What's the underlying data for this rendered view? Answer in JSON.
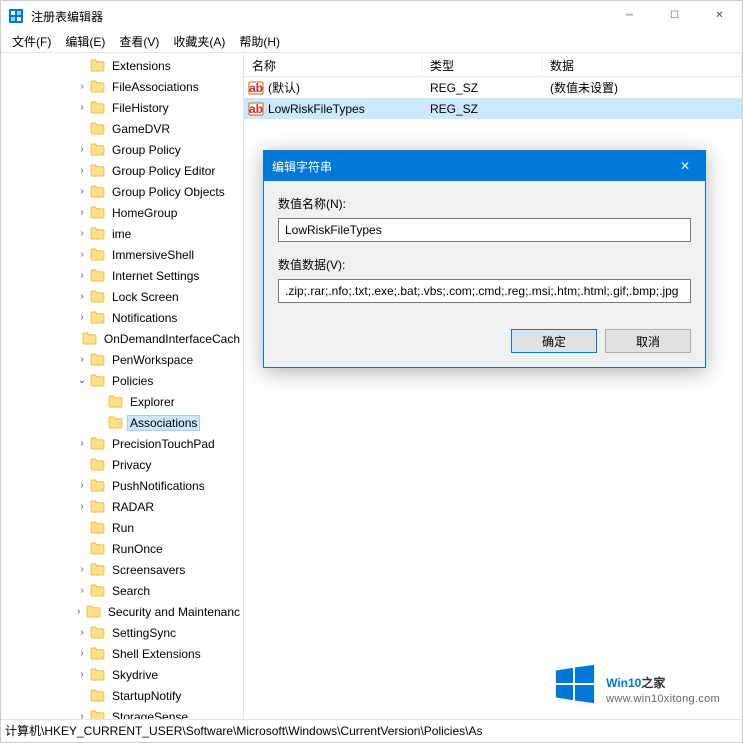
{
  "window": {
    "title": "注册表编辑器"
  },
  "menu": {
    "file": "文件(F)",
    "edit": "编辑(E)",
    "view": "查看(V)",
    "favorites": "收藏夹(A)",
    "help": "帮助(H)"
  },
  "tree_items": [
    {
      "label": "Extensions",
      "depth": 3,
      "expandable": false,
      "expanded": false
    },
    {
      "label": "FileAssociations",
      "depth": 3,
      "expandable": true,
      "expanded": false
    },
    {
      "label": "FileHistory",
      "depth": 3,
      "expandable": true,
      "expanded": false
    },
    {
      "label": "GameDVR",
      "depth": 3,
      "expandable": false,
      "expanded": false
    },
    {
      "label": "Group Policy",
      "depth": 3,
      "expandable": true,
      "expanded": false
    },
    {
      "label": "Group Policy Editor",
      "depth": 3,
      "expandable": true,
      "expanded": false
    },
    {
      "label": "Group Policy Objects",
      "depth": 3,
      "expandable": true,
      "expanded": false
    },
    {
      "label": "HomeGroup",
      "depth": 3,
      "expandable": true,
      "expanded": false
    },
    {
      "label": "ime",
      "depth": 3,
      "expandable": true,
      "expanded": false
    },
    {
      "label": "ImmersiveShell",
      "depth": 3,
      "expandable": true,
      "expanded": false
    },
    {
      "label": "Internet Settings",
      "depth": 3,
      "expandable": true,
      "expanded": false
    },
    {
      "label": "Lock Screen",
      "depth": 3,
      "expandable": true,
      "expanded": false
    },
    {
      "label": "Notifications",
      "depth": 3,
      "expandable": true,
      "expanded": false
    },
    {
      "label": "OnDemandInterfaceCach",
      "depth": 3,
      "expandable": false,
      "expanded": false
    },
    {
      "label": "PenWorkspace",
      "depth": 3,
      "expandable": true,
      "expanded": false
    },
    {
      "label": "Policies",
      "depth": 3,
      "expandable": true,
      "expanded": true
    },
    {
      "label": "Explorer",
      "depth": 4,
      "expandable": false,
      "expanded": false
    },
    {
      "label": "Associations",
      "depth": 4,
      "expandable": false,
      "expanded": false,
      "selected": true
    },
    {
      "label": "PrecisionTouchPad",
      "depth": 3,
      "expandable": true,
      "expanded": false
    },
    {
      "label": "Privacy",
      "depth": 3,
      "expandable": false,
      "expanded": false
    },
    {
      "label": "PushNotifications",
      "depth": 3,
      "expandable": true,
      "expanded": false
    },
    {
      "label": "RADAR",
      "depth": 3,
      "expandable": true,
      "expanded": false
    },
    {
      "label": "Run",
      "depth": 3,
      "expandable": false,
      "expanded": false
    },
    {
      "label": "RunOnce",
      "depth": 3,
      "expandable": false,
      "expanded": false
    },
    {
      "label": "Screensavers",
      "depth": 3,
      "expandable": true,
      "expanded": false
    },
    {
      "label": "Search",
      "depth": 3,
      "expandable": true,
      "expanded": false
    },
    {
      "label": "Security and Maintenanc",
      "depth": 3,
      "expandable": true,
      "expanded": false
    },
    {
      "label": "SettingSync",
      "depth": 3,
      "expandable": true,
      "expanded": false
    },
    {
      "label": "Shell Extensions",
      "depth": 3,
      "expandable": true,
      "expanded": false
    },
    {
      "label": "Skydrive",
      "depth": 3,
      "expandable": true,
      "expanded": false
    },
    {
      "label": "StartupNotify",
      "depth": 3,
      "expandable": false,
      "expanded": false
    },
    {
      "label": "StorageSense",
      "depth": 3,
      "expandable": true,
      "expanded": false
    }
  ],
  "list": {
    "columns": {
      "name": "名称",
      "type": "类型",
      "data": "数据"
    },
    "rows": [
      {
        "name": "(默认)",
        "type": "REG_SZ",
        "data": "(数值未设置)",
        "selected": false
      },
      {
        "name": "LowRiskFileTypes",
        "type": "REG_SZ",
        "data": "",
        "selected": true
      }
    ]
  },
  "statusbar": "计算机\\HKEY_CURRENT_USER\\Software\\Microsoft\\Windows\\CurrentVersion\\Policies\\As",
  "dialog": {
    "title": "编辑字符串",
    "name_label": "数值名称(N):",
    "name_value": "LowRiskFileTypes",
    "data_label": "数值数据(V):",
    "data_value": ".zip;.rar;.nfo;.txt;.exe;.bat;.vbs;.com;.cmd;.reg;.msi;.htm;.html;.gif;.bmp;.jpg",
    "ok": "确定",
    "cancel": "取消"
  },
  "watermark": {
    "brand_prefix": "Win10",
    "brand_suffix": "之家",
    "url": "www.win10xitong.com"
  }
}
